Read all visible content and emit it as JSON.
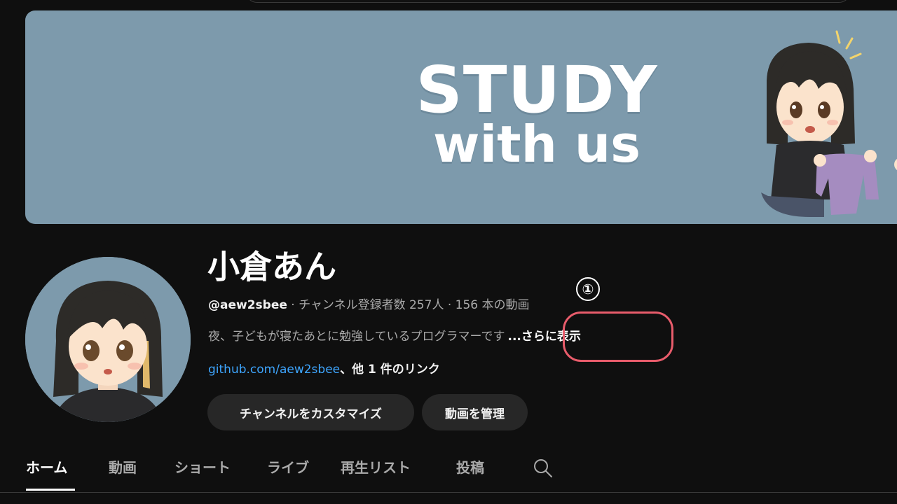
{
  "banner": {
    "line1": "STUDY",
    "line2": "with us"
  },
  "channel": {
    "name": "小倉あん",
    "handle": "@aew2sbee",
    "meta_rest": " · チャンネル登録者数 257人 · 156 本の動画",
    "description": "夜、子どもが寝たあとに勉強しているプログラマーです",
    "more_label": "...さらに表示",
    "link_url": "github.com/aew2sbee",
    "link_more": "、他 1 件のリンク"
  },
  "annotation": {
    "number": "①",
    "color": "#e85c6b"
  },
  "buttons": {
    "customize": "チャンネルをカスタマイズ",
    "manage": "動画を管理"
  },
  "tabs": [
    "ホーム",
    "動画",
    "ショート",
    "ライブ",
    "再生リスト",
    "投稿"
  ],
  "active_tab": "ホーム",
  "icons": {
    "tab_search": "search-icon"
  },
  "colors": {
    "background": "#0f0f0f",
    "banner": "#7d9aac",
    "link": "#3ea6ff",
    "button_bg": "#272727"
  }
}
